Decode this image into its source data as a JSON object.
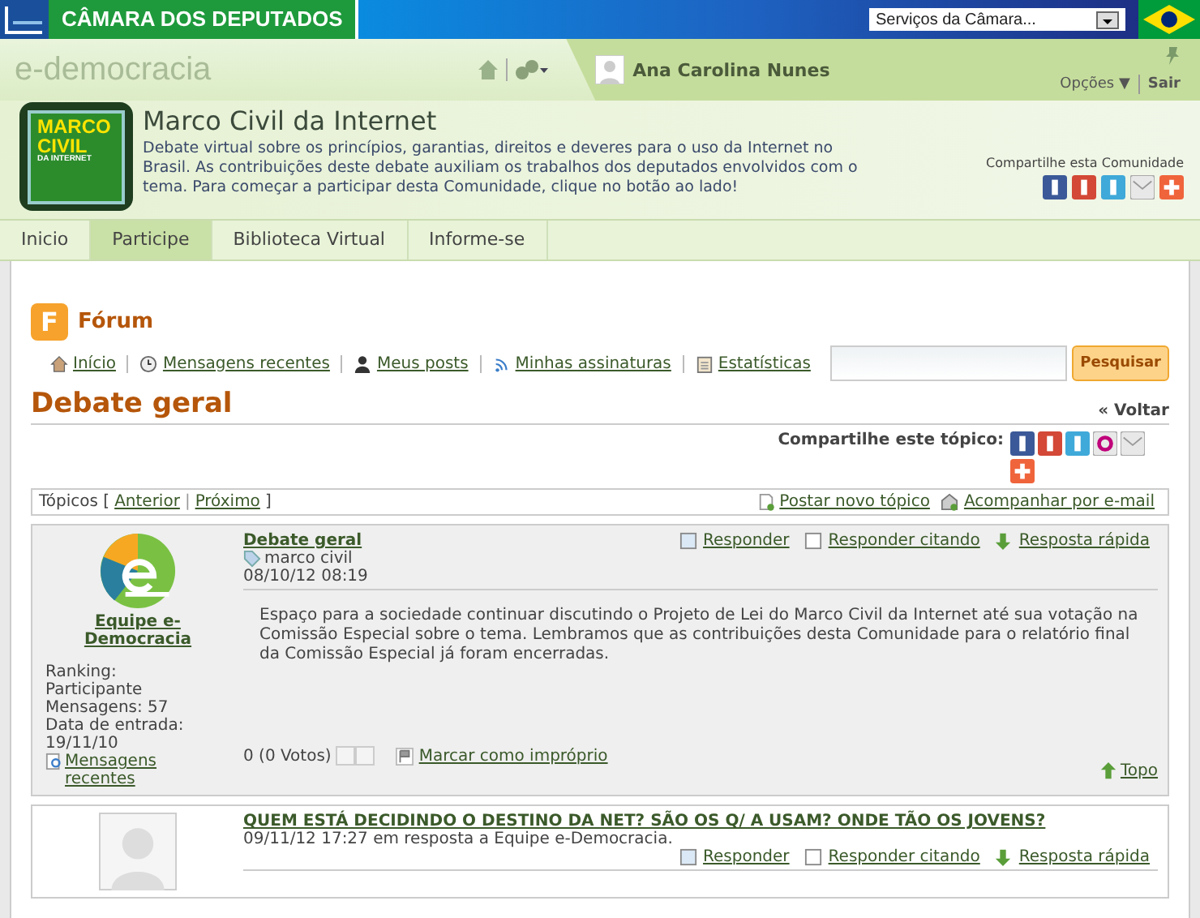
{
  "top_bar": {
    "title": "CÂMARA DOS DEPUTADOS",
    "services_select": {
      "value": "Serviços da Câmara..."
    }
  },
  "nav_bar": {
    "logo": "e-democracia",
    "user_name": "Ana Carolina Nunes",
    "options": "Opções ▼",
    "logout": "Sair"
  },
  "community": {
    "logo_lines": [
      "MARCO",
      "CIVIL",
      "DA INTERNET"
    ],
    "title": "Marco Civil da Internet",
    "description": "Debate virtual sobre os princípios, garantias, direitos e deveres para o uso da Internet no Brasil. As contribuições deste debate auxiliam os trabalhos dos deputados envolvidos com o tema. Para começar a participar desta Comunidade, clique no botão ao lado!",
    "share_label": "Compartilhe esta Comunidade",
    "share_icons": [
      {
        "kind": "facebook"
      },
      {
        "kind": "gplus"
      },
      {
        "kind": "twitter"
      },
      {
        "kind": "email"
      },
      {
        "kind": "plus"
      }
    ]
  },
  "tabs": [
    {
      "label": "Inicio",
      "selected": false
    },
    {
      "label": "Participe",
      "selected": true
    },
    {
      "label": "Biblioteca Virtual",
      "selected": false
    },
    {
      "label": "Informe-se",
      "selected": false
    }
  ],
  "forum": {
    "logo_letter": "F",
    "title": "Fórum",
    "links": [
      {
        "kind": "home",
        "label": "Início"
      },
      {
        "kind": "clock",
        "label": "Mensagens recentes"
      },
      {
        "kind": "person",
        "label": "Meus posts"
      },
      {
        "kind": "rss",
        "label": "Minhas assinaturas"
      },
      {
        "kind": "clipboard",
        "label": "Estatísticas"
      }
    ],
    "search_button": "Pesquisar"
  },
  "thread": {
    "title": "Debate geral",
    "back": "« Voltar",
    "share_label": "Compartilhe este tópico:",
    "share_icons": [
      {
        "kind": "facebook"
      },
      {
        "kind": "gplus"
      },
      {
        "kind": "twitter"
      },
      {
        "kind": "orkut"
      },
      {
        "kind": "email"
      },
      {
        "kind": "plus"
      }
    ],
    "topics_label": "Tópicos [",
    "prev": "Anterior",
    "sep": "|",
    "next": "Próximo",
    "close": "]",
    "new_topic": "Postar novo tópico",
    "subscribe": "Acompanhar por e-mail"
  },
  "posts": [
    {
      "avatar": {
        "kind": "logo"
      },
      "author": "Equipe e-Democracia",
      "stats": [
        "Ranking:",
        "Participante",
        "Mensagens: 57",
        "Data de entrada:",
        "19/11/10"
      ],
      "recent": "Mensagens recentes",
      "title": "Debate geral",
      "tag": "marco civil",
      "meta": "08/10/12 08:19",
      "actions": [
        "Responder",
        "Responder citando",
        "Resposta rápida"
      ],
      "body": "Espaço para a sociedade continuar discutindo o Projeto de Lei do Marco Civil da Internet até sua votação na Comissão Especial sobre o tema. Lembramos que as contribuições desta Comunidade para o relatório final da Comissão Especial já foram encerradas.",
      "votes": "0 (0 Votos)",
      "flag": "Marcar como impróprio",
      "top": "Topo"
    },
    {
      "avatar": {
        "kind": "blank"
      },
      "title": "QUEM ESTÁ DECIDINDO O DESTINO DA NET? SÃO OS Q/ A USAM? ONDE TÃO OS JOVENS?",
      "meta": "09/11/12 17:27 em resposta a Equipe e-Democracia.",
      "actions": [
        "Responder",
        "Responder citando",
        "Resposta rápida"
      ]
    }
  ]
}
